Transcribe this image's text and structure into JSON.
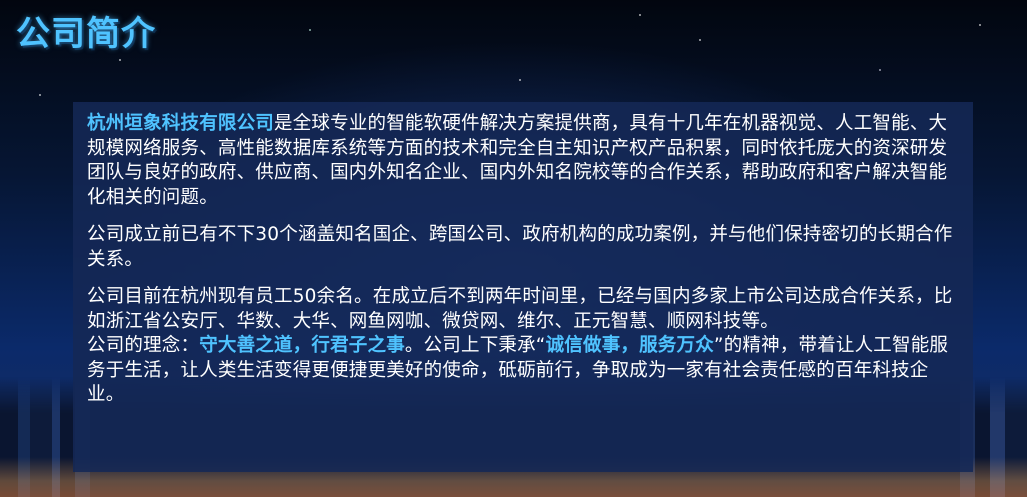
{
  "title": "公司简介",
  "intro": {
    "company": "杭州垣象科技有限公司",
    "text": "是全球专业的智能软硬件解决方案提供商，具有十几年在机器视觉、人工智能、大规模网络服务、高性能数据库系统等方面的技术和完全自主知识产权产品积累，同时依托庞大的资深研发团队与良好的政府、供应商、国内外知名企业、国内外知名院校等的合作关系，帮助政府和客户解决智能化相关的问题。"
  },
  "cases": "公司成立前已有不下30个涵盖知名国企、跨国公司、政府机构的成功案例，并与他们保持密切的长期合作关系。",
  "staff": "公司目前在杭州现有员工50余名。在成立后不到两年时间里，已经与国内多家上市公司达成合作关系，比如浙江省公安厅、华数、大华、网鱼网咖、微贷网、维尔、正元智慧、顺网科技等。",
  "philosophy": {
    "label": "公司的理念：",
    "motto": "守大善之道，行君子之事",
    "mid": "。公司上下秉承“",
    "spirit": "诚信做事，服务万众",
    "rest": "”的精神，带着让人工智能服务于生活，让人类生活变得更便捷更美好的使命，砥砺前行，争取成为一家有社会责任感的百年科技企业。"
  },
  "colors": {
    "accent": "#4fc3ff",
    "card": "#142855",
    "text": "#ffffff"
  }
}
